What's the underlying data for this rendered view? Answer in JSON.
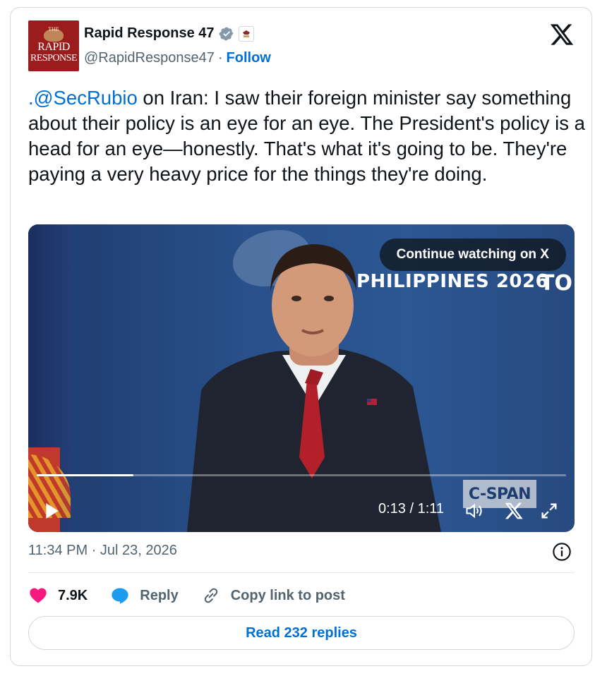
{
  "author": {
    "display_name": "Rapid Response 47",
    "handle": "@RapidResponse47",
    "follow_label": "Follow",
    "avatar_text_top": "THE",
    "avatar_text_main": "RAPID",
    "avatar_text_bottom": "RESPONSE"
  },
  "tweet": {
    "mention": ".@SecRubio",
    "text": " on Iran: I saw their foreign minister say something about their policy is an eye for an eye. The President's policy is a head for an eye—honestly. That's what it's going to be. They're paying a very heavy price for the things they're doing."
  },
  "video": {
    "continue_label": "Continue watching on X",
    "banner_text": "PHILIPPINES 2026",
    "banner_text_right": "TO",
    "watermark": "C-SPAN",
    "time_display": "0:13 / 1:11",
    "progress_fraction": 0.183
  },
  "footer": {
    "timestamp": "11:34 PM · Jul 23, 2026",
    "likes_count": "7.9K",
    "reply_label": "Reply",
    "copy_link_label": "Copy link to post",
    "read_replies_label": "Read 232 replies"
  },
  "colors": {
    "link": "#006fd6",
    "like_heart": "#f91880",
    "reply_bubble": "#1d9bf0",
    "verified_badge": "#829aab",
    "avatar_bg": "#9b1c1c"
  },
  "icons": [
    "verified-badge-icon",
    "affiliate-badge-icon",
    "x-logo-icon",
    "play-icon",
    "volume-icon",
    "x-watermark-icon",
    "fullscreen-icon",
    "info-icon",
    "heart-icon",
    "reply-bubble-icon",
    "link-icon"
  ]
}
